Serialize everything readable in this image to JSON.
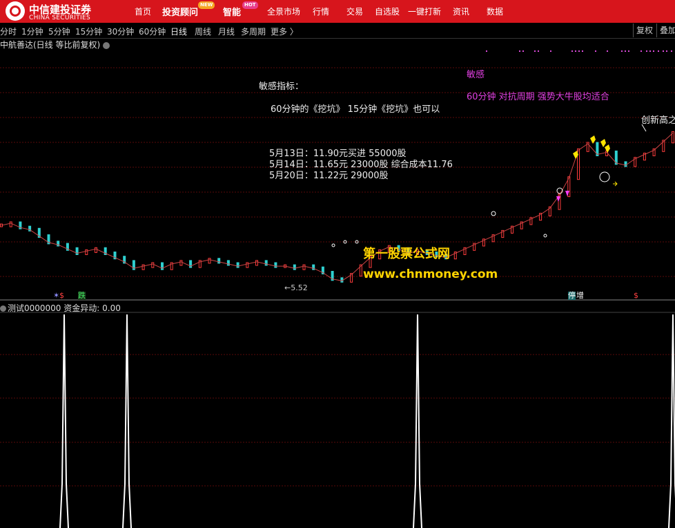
{
  "topnav": {
    "logo_cn": "中信建投证券",
    "logo_en": "CHINA SECURITIES",
    "items": [
      "首页",
      "投资顾问",
      "智能",
      "全景市场",
      "行情",
      "交易",
      "自选股",
      "一键打新",
      "资讯",
      "数据"
    ],
    "badge_new": "NEW",
    "badge_hot": "HOT"
  },
  "periods": [
    "分时",
    "1分钟",
    "5分钟",
    "15分钟",
    "30分钟",
    "60分钟",
    "日线",
    "周线",
    "月线",
    "多周期",
    "更多 〉"
  ],
  "toolbar_right": {
    "fq": "复权",
    "overlay": "叠加"
  },
  "stock": {
    "title": "中航善达(日线 等比前复权)"
  },
  "indicator": {
    "title": "测试0000000 资金异动: 0.00"
  },
  "notes": {
    "header": "敏感指标：",
    "line1": "60分钟的《挖坑》  15分钟《挖坑》也可以",
    "trade1": "5月13日：11.90元买进 55000股",
    "trade2": "5月14日：11.65元  23000股    综合成本11.76",
    "trade3": "5月20日：11.22元   29000股",
    "pink_title": "敏感",
    "pink_line": "60分钟  对抗周期    强势大牛股均适合",
    "new_high": "创新高之",
    "low_label": "←5.52"
  },
  "watermark": {
    "cn": "第一股票公式网",
    "url": "www.chnmoney.com"
  },
  "signals": {
    "s1": "$",
    "s2": "$",
    "die": "跌",
    "ting": "停",
    "zeng": "增",
    "star": "✶"
  },
  "chart_data": {
    "type": "line",
    "title": "中航善达(日线 等比前复权)",
    "low_marker": 5.52,
    "series": [
      {
        "values": [
          8.1,
          8.2,
          8.0,
          7.9,
          7.6,
          7.3,
          7.2,
          7.0,
          6.8,
          6.9,
          7.0,
          6.8,
          6.6,
          6.4,
          6.1,
          6.2,
          6.3,
          6.1,
          6.3,
          6.4,
          6.2,
          6.4,
          6.5,
          6.4,
          6.3,
          6.2,
          6.3,
          6.4,
          6.3,
          6.2,
          6.2,
          6.1,
          6.2,
          6.1,
          5.9,
          5.6,
          5.52,
          5.8,
          6.2,
          6.6,
          6.9,
          7.1,
          7.0,
          6.8,
          6.9,
          6.8,
          6.7,
          6.6,
          6.8,
          7.0,
          7.2,
          7.4,
          7.6,
          7.8,
          8.0,
          8.2,
          8.4,
          8.6,
          8.9,
          9.5,
          10.3,
          11.6,
          11.9,
          11.4,
          11.5,
          11.0,
          10.9,
          11.2,
          11.4,
          11.6,
          12.0,
          12.4
        ]
      }
    ],
    "indicator_spikes": [
      1,
      0,
      1,
      0,
      0,
      1,
      0,
      0,
      1
    ]
  }
}
